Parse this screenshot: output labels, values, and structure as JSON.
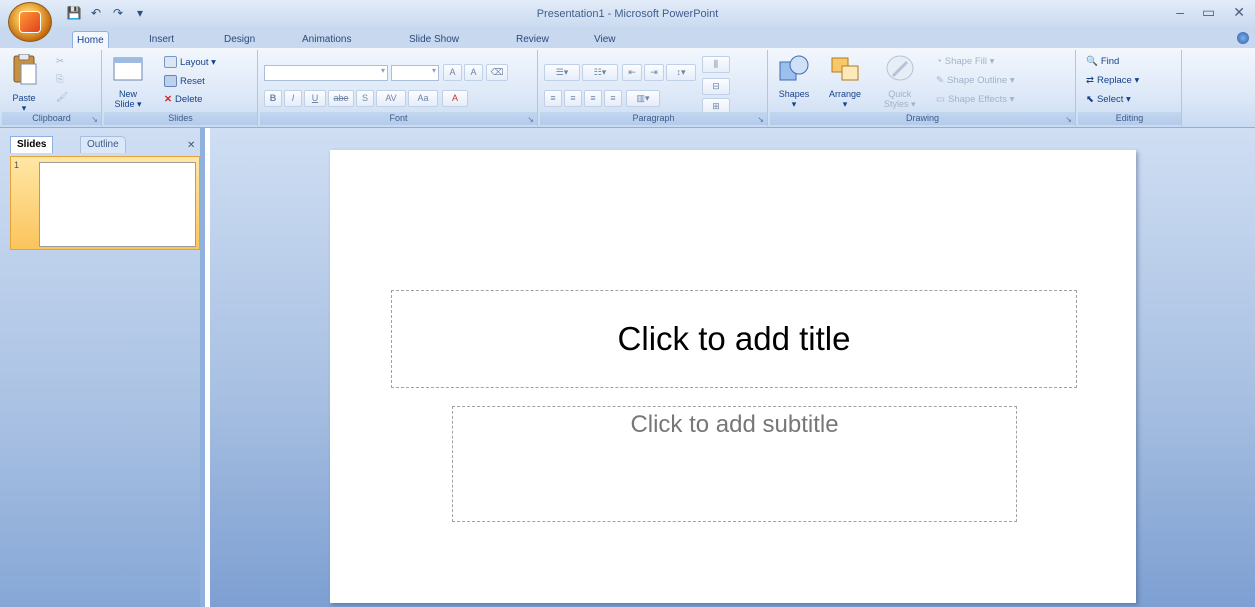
{
  "window": {
    "title": "Presentation1 - Microsoft PowerPoint",
    "controls": [
      "–",
      "▭",
      "✕"
    ]
  },
  "qat": [
    "💾",
    "↶",
    "↷",
    "▾"
  ],
  "tabs": [
    "Home",
    "Insert",
    "Design",
    "Animations",
    "Slide Show",
    "Review",
    "View"
  ],
  "ribbon": {
    "clipboard": {
      "label": "Clipboard",
      "paste": "Paste"
    },
    "slides": {
      "label": "Slides",
      "new_slide_1": "New",
      "new_slide_2": "Slide ▾",
      "layout": "Layout ▾",
      "reset": "Reset",
      "delete": "Delete"
    },
    "font": {
      "label": "Font",
      "bold": "B",
      "italic": "I",
      "underline": "U",
      "strike": "abe",
      "shadow": "S",
      "spacing": "AV",
      "change_case": "Aa",
      "color": "A",
      "grow": "A",
      "shrink": "A",
      "clear": "⌫"
    },
    "paragraph": {
      "label": "Paragraph"
    },
    "drawing": {
      "label": "Drawing",
      "shapes": "Shapes",
      "arrange": "Arrange",
      "quick_styles_1": "Quick",
      "quick_styles_2": "Styles ▾",
      "shape_fill": "Shape Fill ▾",
      "shape_outline": "Shape Outline ▾",
      "shape_effects": "Shape Effects ▾"
    },
    "editing": {
      "label": "Editing",
      "find": "Find",
      "replace": "Replace ▾",
      "select": "Select ▾"
    }
  },
  "left_pane": {
    "tabs": [
      "Slides",
      "Outline"
    ],
    "close": "✕",
    "slide_number": "1"
  },
  "slide": {
    "title_placeholder": "Click to add title",
    "subtitle_placeholder": "Click to add subtitle"
  }
}
